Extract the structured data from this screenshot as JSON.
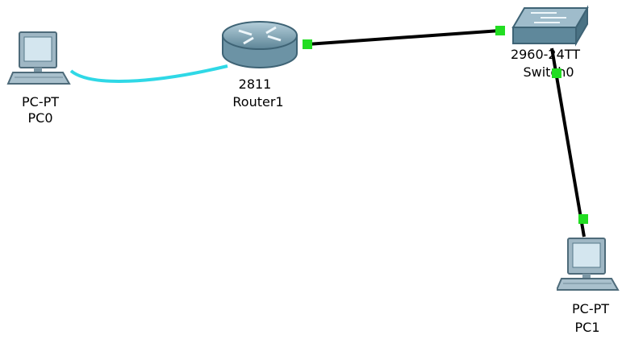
{
  "devices": {
    "pc0": {
      "model": "PC-PT",
      "name": "PC0"
    },
    "router1": {
      "model": "2811",
      "name": "Router1"
    },
    "switch0": {
      "model": "2960-24TT",
      "name": "Switch0"
    },
    "pc1": {
      "model": "PC-PT",
      "name": "PC1"
    }
  },
  "links": [
    {
      "from": "pc0",
      "to": "router1",
      "cable": "console",
      "color": "#2fd8e6"
    },
    {
      "from": "router1",
      "to": "switch0",
      "cable": "straight-through",
      "color": "#000000",
      "port_status": "up"
    },
    {
      "from": "switch0",
      "to": "pc1",
      "cable": "straight-through",
      "color": "#000000",
      "port_status": "up"
    }
  ],
  "colors": {
    "port_up": "#22dd22",
    "background": "#ffffff"
  }
}
